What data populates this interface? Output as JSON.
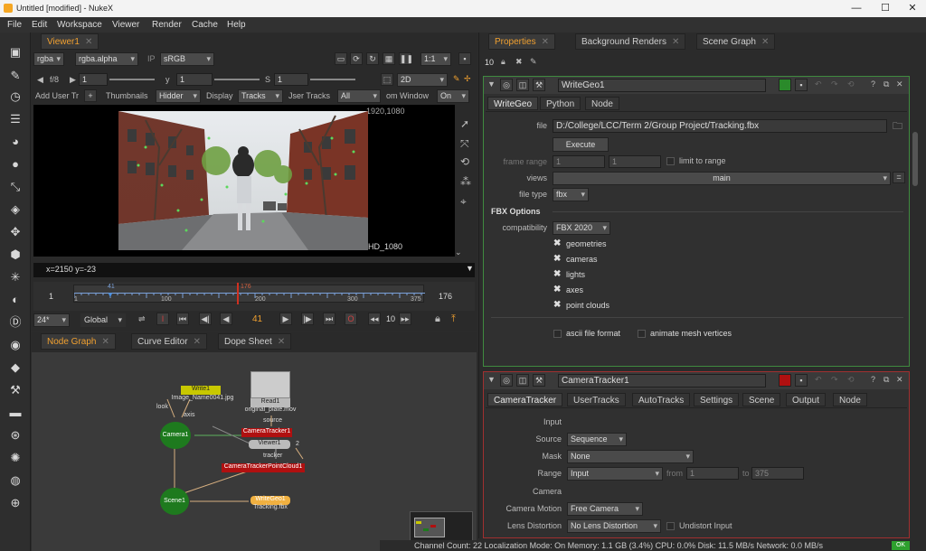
{
  "window": {
    "title": "Untitled [modified] - NukeX",
    "min": "—",
    "max": "☐",
    "close": "✕"
  },
  "menu": [
    "File",
    "Edit",
    "Workspace",
    "Viewer",
    "Render",
    "Cache",
    "Help"
  ],
  "viewer": {
    "tab": "Viewer1",
    "channels": "rgba",
    "alpha": "rgba.alpha",
    "ip": "IP",
    "colorspace": "sRGB",
    "zoom": "1:1",
    "fstop": "f/8",
    "gain": "1",
    "gamma_label": "y",
    "gamma": "1",
    "s_label": "S",
    "s": "1",
    "mode": "2D",
    "add_user_track": "Add User Tr",
    "thumbnails_label": "Thumbnails",
    "thumbnails_val": "Hidder",
    "display_label": "Display",
    "display_val": "Tracks",
    "user_tracks_label": "Jser Tracks",
    "user_tracks_val": "All",
    "zoom_window_label": "om Window",
    "zoom_window_val": "On",
    "format_top": "1920,1080",
    "format_bottom": "HD_1080",
    "coords": "x=2150 y=-23",
    "timeline": {
      "start": "1",
      "end": "176",
      "labels": [
        "1",
        "100",
        "200",
        "300",
        "375"
      ],
      "marker_in": "41",
      "current": "176"
    },
    "fps": "24*",
    "global": "Global",
    "frame": "41",
    "step": "10"
  },
  "nodegraph": {
    "tabs": [
      "Node Graph",
      "Curve Editor",
      "Dope Sheet"
    ],
    "nodes": {
      "write1": "Write1",
      "write1_file": "Image_Name0041.jpg",
      "read1": "Read1",
      "read1_file": "original_plate.mov",
      "camera1": "Camera1",
      "cameratracker1": "CameraTracker1",
      "viewer1": "Viewer1",
      "ctpc": "CameraTrackerPointCloud1",
      "scene1": "Scene1",
      "writegeo1": "WriteGeo1",
      "writegeo1_file": "Tracking.fbx",
      "lookat": "look",
      "axis": "axis",
      "source": "source",
      "tracker": "tracker",
      "two": "2"
    }
  },
  "properties": {
    "tabs": [
      "Properties",
      "Background Renders",
      "Scene Graph"
    ],
    "count": "10",
    "writegeo": {
      "name": "WriteGeo1",
      "tabs": [
        "WriteGeo",
        "Python",
        "Node"
      ],
      "file_label": "file",
      "file": "D:/College/LCC/Term 2/Group Project/Tracking.fbx",
      "execute": "Execute",
      "frame_range_label": "frame range",
      "fr_start": "1",
      "fr_end": "1",
      "limit_label": "limit to range",
      "views_label": "views",
      "views": "main",
      "file_type_label": "file type",
      "file_type": "fbx",
      "fbx_options": "FBX Options",
      "compat_label": "compatibility",
      "compat": "FBX 2020",
      "checks": [
        "geometries",
        "cameras",
        "lights",
        "axes",
        "point clouds"
      ],
      "ascii": "ascii file format",
      "animate": "animate mesh vertices"
    },
    "tracker": {
      "name": "CameraTracker1",
      "tabs": [
        "CameraTracker",
        "UserTracks",
        "AutoTracks",
        "Settings",
        "Scene",
        "Output",
        "Node"
      ],
      "input_header": "Input",
      "source_label": "Source",
      "source": "Sequence",
      "mask_label": "Mask",
      "mask": "None",
      "range_label": "Range",
      "range": "Input",
      "from": "from",
      "from_val": "1",
      "to": "to",
      "to_val": "375",
      "camera_header": "Camera",
      "motion_label": "Camera Motion",
      "motion": "Free Camera",
      "lens_label": "Lens Distortion",
      "lens": "No Lens Distortion",
      "undistort": "Undistort Input"
    }
  },
  "status": {
    "text": "Channel Count: 22  Localization Mode: On  Memory: 1.1 GB (3.4%)  CPU: 0.0%  Disk: 11.5 MB/s  Network: 0.0 MB/s",
    "ok": "OK"
  },
  "colors": {
    "accent": "#f0a030",
    "camera": "#1e7a1e",
    "write": "#c8c800",
    "tracker": "#b01010",
    "writegeo": "#f0b040"
  }
}
